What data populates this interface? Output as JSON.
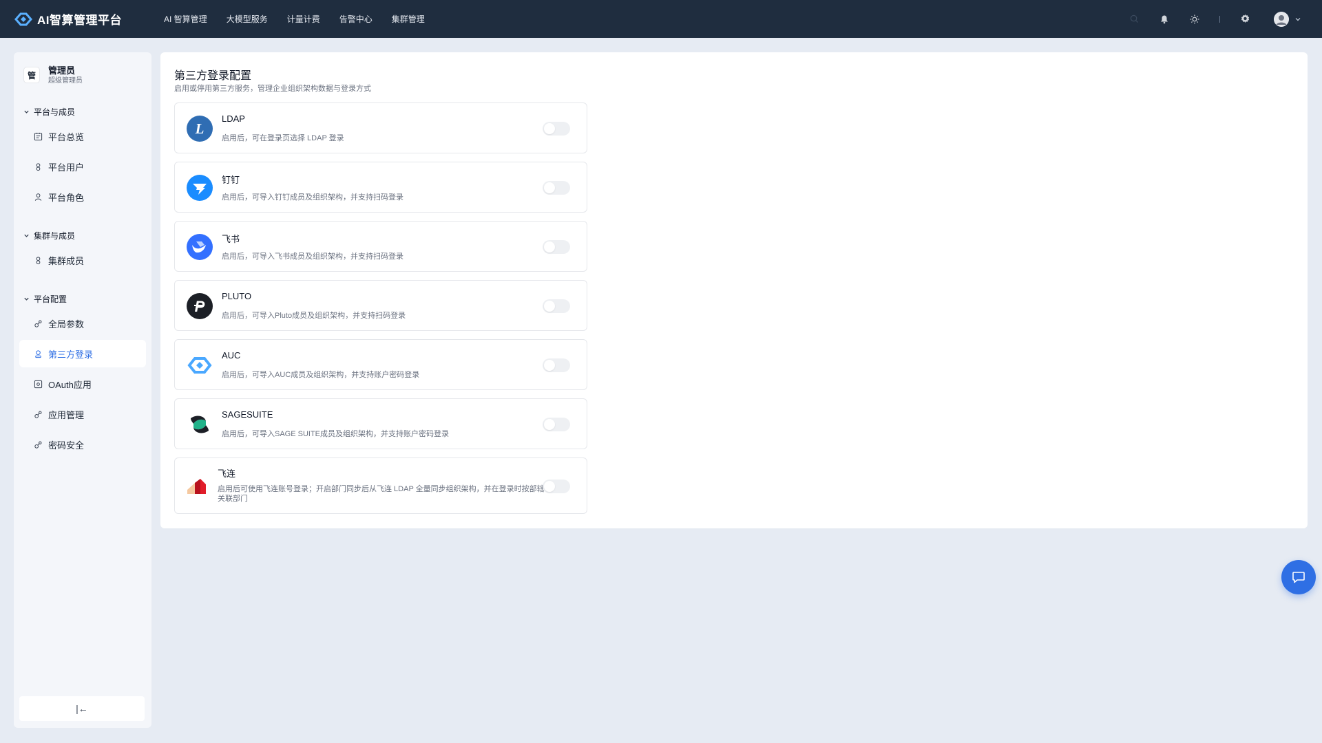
{
  "app": {
    "title": "AI智算管理平台"
  },
  "topnav": [
    "AI 智算管理",
    "大模型服务",
    "计量计费",
    "告警中心",
    "集群管理"
  ],
  "topbar_icons": [
    "search-icon",
    "bell-icon",
    "sun-icon",
    "gear-icon",
    "avatar",
    "chevron-down-icon"
  ],
  "sidebar": {
    "admin": {
      "initial": "管",
      "name": "管理员",
      "role": "超级管理员"
    },
    "groups": [
      {
        "title": "平台与成员",
        "items": [
          {
            "label": "平台总览",
            "icon": "overview-icon"
          },
          {
            "label": "平台用户",
            "icon": "user-icon"
          },
          {
            "label": "平台角色",
            "icon": "role-icon"
          }
        ]
      },
      {
        "title": "集群与成员",
        "items": [
          {
            "label": "集群成员",
            "icon": "user-icon"
          }
        ]
      },
      {
        "title": "平台配置",
        "items": [
          {
            "label": "全局参数",
            "icon": "settings-icon"
          },
          {
            "label": "第三方登录",
            "icon": "login-icon",
            "active": true
          },
          {
            "label": "OAuth应用",
            "icon": "oauth-icon"
          },
          {
            "label": "应用管理",
            "icon": "settings-icon"
          },
          {
            "label": "密码安全",
            "icon": "settings-icon"
          }
        ]
      }
    ],
    "collapse_label": "|←"
  },
  "main": {
    "title": "第三方登录配置",
    "subtitle": "启用或停用第三方服务，管理企业组织架构数据与登录方式",
    "providers": [
      {
        "name": "LDAP",
        "desc": "启用后，可在登录页选择 LDAP 登录",
        "enabled": false
      },
      {
        "name": "钉钉",
        "desc": "启用后，可导入钉钉成员及组织架构，并支持扫码登录",
        "enabled": false
      },
      {
        "name": "飞书",
        "desc": "启用后，可导入飞书成员及组织架构，并支持扫码登录",
        "enabled": false
      },
      {
        "name": "PLUTO",
        "desc": "启用后，可导入Pluto成员及组织架构，并支持扫码登录",
        "enabled": false
      },
      {
        "name": "AUC",
        "desc": "启用后，可导入AUC成员及组织架构，并支持账户密码登录",
        "enabled": false
      },
      {
        "name": "SAGESUITE",
        "desc": "启用后，可导入SAGE SUITE成员及组织架构，并支持账户密码登录",
        "enabled": false
      },
      {
        "name": "飞连",
        "desc": "启用后可使用飞连账号登录；开启部门同步后从飞连 LDAP 全量同步组织架构，并在登录时按部辖关联部门",
        "enabled": false
      }
    ]
  },
  "colors": {
    "topbar": "#1f2d3f",
    "accent": "#2f6fe4",
    "page_bg": "#e6ebf3"
  }
}
